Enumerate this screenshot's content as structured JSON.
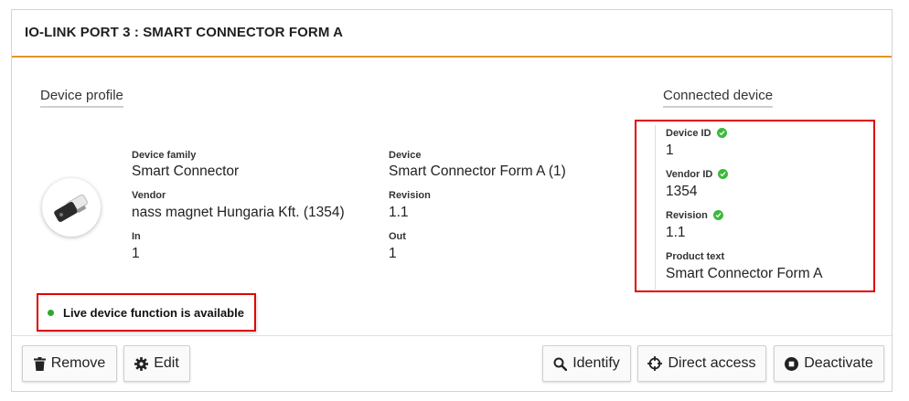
{
  "header": {
    "title": "IO-LINK PORT 3 : SMART CONNECTOR FORM A"
  },
  "profile": {
    "section_label": "Device profile",
    "device_family_label": "Device family",
    "device_family": "Smart Connector",
    "vendor_label": "Vendor",
    "vendor": "nass magnet Hungaria Kft. (1354)",
    "in_label": "In",
    "in": "1",
    "device_label": "Device",
    "device": "Smart Connector Form A (1)",
    "revision_label": "Revision",
    "revision": "1.1",
    "out_label": "Out",
    "out": "1"
  },
  "connected": {
    "section_label": "Connected device",
    "device_id_label": "Device ID",
    "device_id": "1",
    "vendor_id_label": "Vendor ID",
    "vendor_id": "1354",
    "revision_label": "Revision",
    "revision": "1.1",
    "product_text_label": "Product text",
    "product_text": "Smart Connector Form A"
  },
  "status": {
    "live_text": "Live device function is available",
    "dot_color": "#2ea82e"
  },
  "buttons": {
    "remove": "Remove",
    "edit": "Edit",
    "identify": "Identify",
    "direct_access": "Direct access",
    "deactivate": "Deactivate"
  },
  "colors": {
    "accent": "#e1962a",
    "highlight": "#e00000",
    "check": "#3cb93c"
  },
  "icons": [
    "device-image",
    "check-icon",
    "trash-icon",
    "gear-icon",
    "search-icon",
    "crosshair-icon",
    "stop-circle-icon"
  ]
}
